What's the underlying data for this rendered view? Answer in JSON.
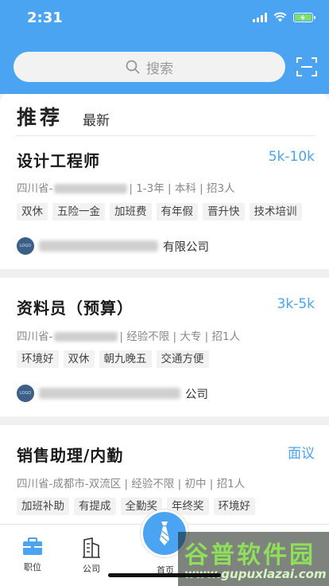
{
  "status": {
    "time": "2:31"
  },
  "search": {
    "placeholder": "搜索"
  },
  "tabs": [
    {
      "label": "推荐",
      "active": true
    },
    {
      "label": "最新",
      "active": false
    }
  ],
  "jobs": [
    {
      "title": "设计工程师",
      "salary": "5k-10k",
      "location_prefix": "四川省-",
      "details": "| 1-3年 | 本科 | 招3人",
      "tags": [
        "双休",
        "五险一金",
        "加班费",
        "有年假",
        "晋升快",
        "技术培训"
      ],
      "company_suffix": "有限公司"
    },
    {
      "title": "资料员（预算）",
      "salary": "3k-5k",
      "location_prefix": "四川省-",
      "details": "| 经验不限 | 大专 | 招1人",
      "tags": [
        "环境好",
        "双休",
        "朝九晚五",
        "交通方便"
      ],
      "company_suffix": "公司"
    },
    {
      "title": "销售助理/内勤",
      "salary": "面议",
      "location_prefix": "四川省-成都市-双流区",
      "details": "| 经验不限 | 初中 | 招1人",
      "tags": [
        "加班补助",
        "有提成",
        "全勤奖",
        "年终奖",
        "环境好"
      ]
    }
  ],
  "nav": {
    "jobs": "职位",
    "company": "公司",
    "home": "首页"
  },
  "watermark": {
    "title": "谷普软件园",
    "url": "www.gupuxlazai.com"
  },
  "colors": {
    "brand": "#4aa4f1",
    "salary": "#4aa4f1"
  }
}
